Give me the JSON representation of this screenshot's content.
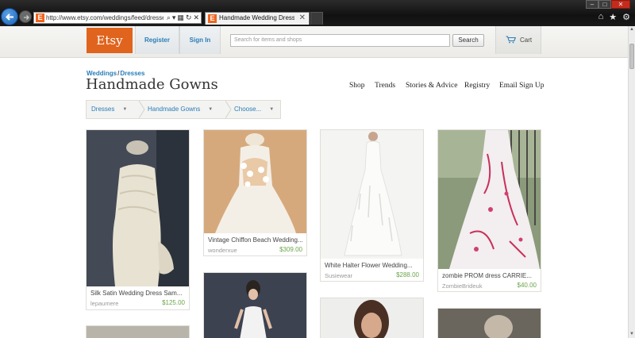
{
  "browser": {
    "url": "http://www.etsy.com/weddings/feed/dresses/h",
    "tab_title": "Handmade Wedding Dress...",
    "favicon_letter": "E",
    "window_controls": [
      "–",
      "□",
      "✕"
    ],
    "toolbar_icons": [
      "home-icon",
      "star-icon",
      "gear-icon"
    ]
  },
  "header": {
    "logo": "Etsy",
    "register": "Register",
    "sign_in": "Sign In",
    "search_placeholder": "Search for items and shops",
    "search_button": "Search",
    "cart": "Cart"
  },
  "breadcrumb": {
    "first": "Weddings",
    "separator": "/",
    "second": "Dresses"
  },
  "page_title": "Handmade Gowns",
  "top_nav": [
    "Shop",
    "Trends",
    "Stories & Advice",
    "Registry",
    "Email Sign Up"
  ],
  "filters": [
    "Dresses",
    "Handmade Gowns",
    "Choose..."
  ],
  "listings": [
    {
      "title": "Silk Satin Wedding Dress Sam...",
      "shop": "lepaumere",
      "price": "$125.00"
    },
    {
      "title": "Vintage Chiffon Beach Wedding...",
      "shop": "wonderxue",
      "price": "$309.00"
    },
    {
      "title": "White Halter Flower Wedding...",
      "shop": "Susiewear",
      "price": "$288.00"
    },
    {
      "title": "zombie PROM dress CARRIE...",
      "shop": "ZombieBrideuk",
      "price": "$40.00"
    }
  ],
  "colors": {
    "etsy_orange": "#e0641e",
    "link_blue": "#2a7db8",
    "price_green": "#6aa54a"
  }
}
